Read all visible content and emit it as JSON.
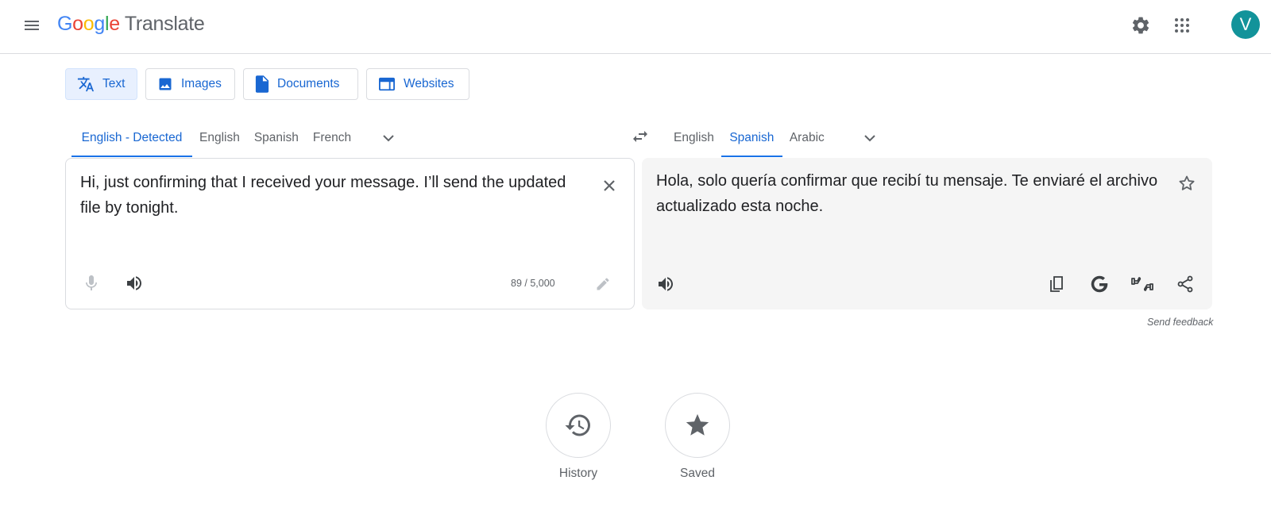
{
  "header": {
    "logo_google": "Google",
    "logo_product": "Translate",
    "avatar_initial": "V",
    "icons": [
      "menu-icon",
      "gear-icon",
      "apps-grid-icon"
    ]
  },
  "mode_tabs": [
    {
      "label": "Text",
      "icon": "translate-icon",
      "active": true
    },
    {
      "label": "Images",
      "icon": "image-icon",
      "active": false
    },
    {
      "label": "Documents",
      "icon": "document-icon",
      "active": false
    },
    {
      "label": "Websites",
      "icon": "website-icon",
      "active": false
    }
  ],
  "source_langs": [
    {
      "label": "English - Detected",
      "active": true
    },
    {
      "label": "English",
      "active": false
    },
    {
      "label": "Spanish",
      "active": false
    },
    {
      "label": "French",
      "active": false
    }
  ],
  "target_langs": [
    {
      "label": "English",
      "active": false
    },
    {
      "label": "Spanish",
      "active": true
    },
    {
      "label": "Arabic",
      "active": false
    }
  ],
  "source": {
    "text": "Hi, just confirming that I received your message. I’ll send the updated file by tonight.",
    "char_count": "89 / 5,000"
  },
  "target": {
    "text": "Hola, solo quería confirmar que recibí tu mensaje. Te enviaré el archivo actualizado esta noche."
  },
  "send_feedback": "Send feedback",
  "quick_links": [
    {
      "label": "History",
      "icon": "history-icon"
    },
    {
      "label": "Saved",
      "icon": "star-icon"
    }
  ],
  "colors": {
    "accent": "#1a73e8",
    "active_text": "#1967d2",
    "avatar_bg": "#12939a",
    "target_bg": "#f5f5f5"
  }
}
